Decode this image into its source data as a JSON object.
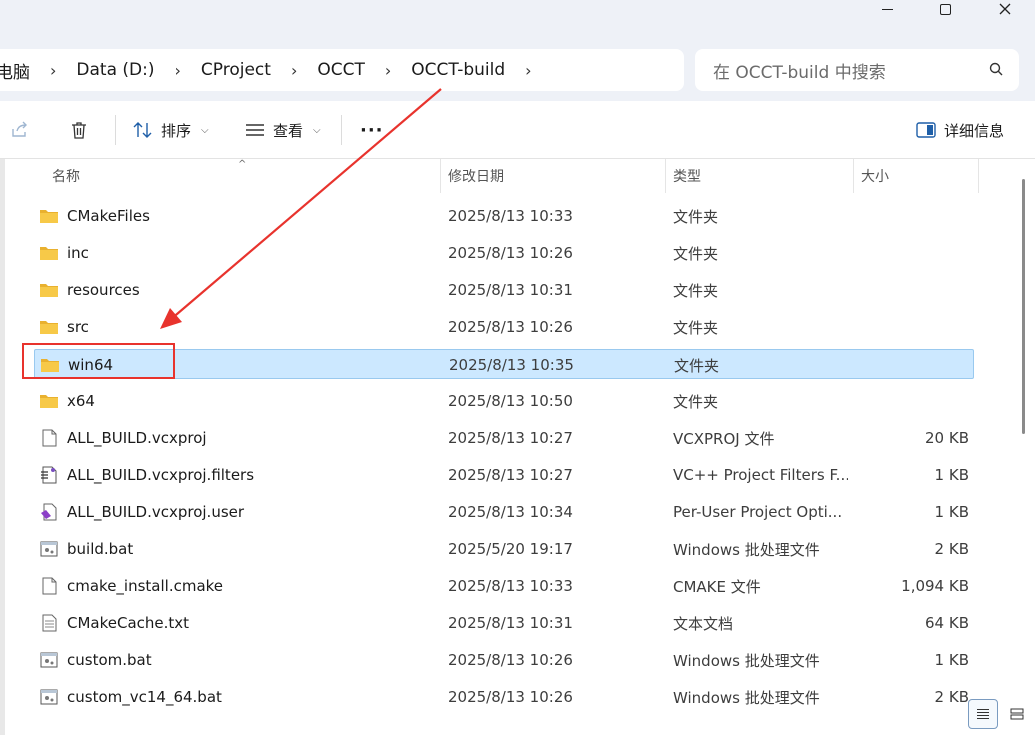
{
  "window": {
    "minimize_label": "—",
    "maximize_label": "□",
    "close_label": "✕"
  },
  "address": {
    "crumbs": [
      "电脑",
      "Data (D:)",
      "CProject",
      "OCCT",
      "OCCT-build"
    ],
    "separator": "›"
  },
  "search": {
    "placeholder": "在 OCCT-build 中搜索",
    "icon": "search-icon"
  },
  "toolbar": {
    "share_icon": "share-icon",
    "delete_icon": "trash-icon",
    "sort_label": "排序",
    "view_label": "查看",
    "more_label": "···",
    "details_label": "详细信息"
  },
  "columns": {
    "name": "名称",
    "date": "修改日期",
    "type": "类型",
    "size": "大小"
  },
  "files": [
    {
      "name": "CMakeFiles",
      "date": "2025/8/13 10:33",
      "type": "文件夹",
      "size": "",
      "icon": "folder-icon"
    },
    {
      "name": "inc",
      "date": "2025/8/13 10:26",
      "type": "文件夹",
      "size": "",
      "icon": "folder-icon"
    },
    {
      "name": "resources",
      "date": "2025/8/13 10:31",
      "type": "文件夹",
      "size": "",
      "icon": "folder-icon"
    },
    {
      "name": "src",
      "date": "2025/8/13 10:26",
      "type": "文件夹",
      "size": "",
      "icon": "folder-icon"
    },
    {
      "name": "win64",
      "date": "2025/8/13 10:35",
      "type": "文件夹",
      "size": "",
      "icon": "folder-icon",
      "selected": true
    },
    {
      "name": "x64",
      "date": "2025/8/13 10:50",
      "type": "文件夹",
      "size": "",
      "icon": "folder-icon"
    },
    {
      "name": "ALL_BUILD.vcxproj",
      "date": "2025/8/13 10:27",
      "type": "VCXPROJ 文件",
      "size": "20 KB",
      "icon": "file-icon"
    },
    {
      "name": "ALL_BUILD.vcxproj.filters",
      "date": "2025/8/13 10:27",
      "type": "VC++ Project Filters F...",
      "size": "1 KB",
      "icon": "filters-file-icon"
    },
    {
      "name": "ALL_BUILD.vcxproj.user",
      "date": "2025/8/13 10:34",
      "type": "Per-User Project Opti...",
      "size": "1 KB",
      "icon": "vs-user-file-icon"
    },
    {
      "name": "build.bat",
      "date": "2025/5/20 19:17",
      "type": "Windows 批处理文件",
      "size": "2 KB",
      "icon": "batch-file-icon"
    },
    {
      "name": "cmake_install.cmake",
      "date": "2025/8/13 10:33",
      "type": "CMAKE 文件",
      "size": "1,094 KB",
      "icon": "file-icon"
    },
    {
      "name": "CMakeCache.txt",
      "date": "2025/8/13 10:31",
      "type": "文本文档",
      "size": "64 KB",
      "icon": "text-file-icon"
    },
    {
      "name": "custom.bat",
      "date": "2025/8/13 10:26",
      "type": "Windows 批处理文件",
      "size": "1 KB",
      "icon": "batch-file-icon"
    },
    {
      "name": "custom_vc14_64.bat",
      "date": "2025/8/13 10:26",
      "type": "Windows 批处理文件",
      "size": "2 KB",
      "icon": "batch-file-icon"
    }
  ],
  "colors": {
    "selection_bg": "#cce8ff",
    "selection_border": "#99c9ef",
    "annotation_red": "#e8332d",
    "folder_yellow": "#f7c948"
  },
  "statusbar": {
    "details_view_icon": "details-view-icon",
    "tiles_view_icon": "tiles-view-icon"
  }
}
